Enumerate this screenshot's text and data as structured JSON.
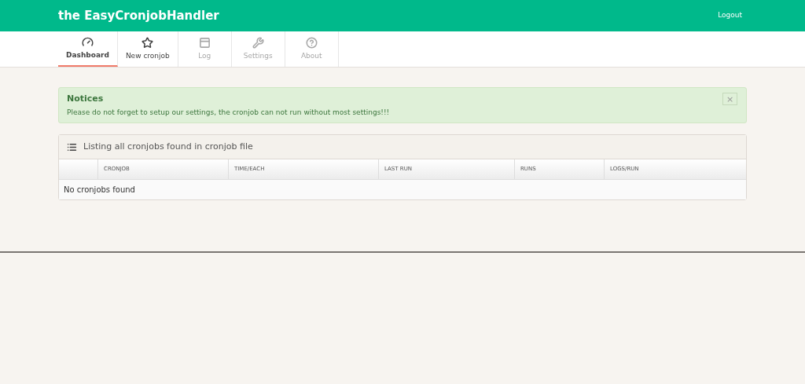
{
  "header": {
    "brand": "the EasyCronjobHandler",
    "logout": "Logout"
  },
  "tabs": [
    {
      "label": "Dashboard",
      "selected": true,
      "disabled": false
    },
    {
      "label": "New cronjob",
      "selected": false,
      "disabled": false
    },
    {
      "label": "Log",
      "selected": false,
      "disabled": true
    },
    {
      "label": "Settings",
      "selected": false,
      "disabled": true
    },
    {
      "label": "About",
      "selected": false,
      "disabled": true
    }
  ],
  "notice": {
    "title": "Notices",
    "message": "Please do not forget to setup our settings, the cronjob can not run without most settings!!!",
    "close": "×"
  },
  "panel": {
    "title": "Listing all cronjobs found in cronjob file",
    "columns": [
      "CRONJOB",
      "TIME/EACH",
      "LAST RUN",
      "RUNS",
      "LOGS/RUN"
    ],
    "empty": "No cronjobs found"
  }
}
